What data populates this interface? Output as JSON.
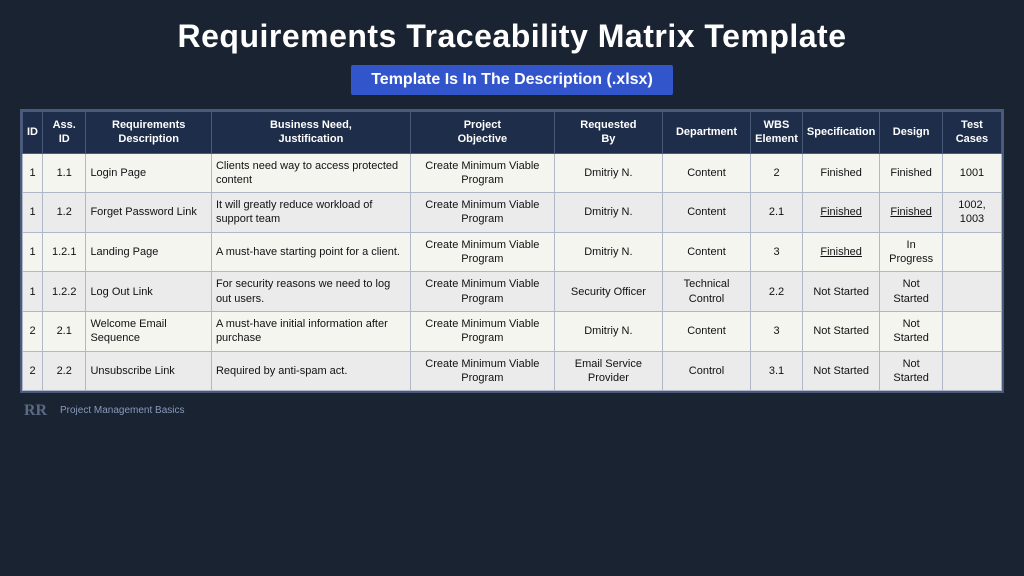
{
  "title": "Requirements Traceability Matrix Template",
  "subtitle": "Template Is In The Description (.xlsx)",
  "table": {
    "headers": [
      {
        "label": "ID",
        "key": "id"
      },
      {
        "label": "Ass. ID",
        "key": "ass_id"
      },
      {
        "label": "Requirements Description",
        "key": "req_desc"
      },
      {
        "label": "Business Need, Justification",
        "key": "business_need"
      },
      {
        "label": "Project Objective",
        "key": "project_obj"
      },
      {
        "label": "Requested By",
        "key": "requested_by"
      },
      {
        "label": "Department",
        "key": "department"
      },
      {
        "label": "WBS Element",
        "key": "wbs"
      },
      {
        "label": "Specification",
        "key": "specification"
      },
      {
        "label": "Design",
        "key": "design"
      },
      {
        "label": "Test Cases",
        "key": "test_cases"
      }
    ],
    "rows": [
      {
        "id": "1",
        "ass_id": "1.1",
        "req_desc": "Login Page",
        "business_need": "Clients need way to access protected content",
        "project_obj": "Create Minimum Viable Program",
        "requested_by": "Dmitriy N.",
        "department": "Content",
        "wbs": "2",
        "specification": "Finished",
        "specification_underline": false,
        "design": "Finished",
        "design_underline": false,
        "test_cases": "1001"
      },
      {
        "id": "1",
        "ass_id": "1.2",
        "req_desc": "Forget Password Link",
        "business_need": "It will greatly reduce workload of support team",
        "project_obj": "Create Minimum Viable Program",
        "requested_by": "Dmitriy N.",
        "department": "Content",
        "wbs": "2.1",
        "specification": "Finished",
        "specification_underline": true,
        "design": "Finished",
        "design_underline": true,
        "test_cases": "1002, 1003"
      },
      {
        "id": "1",
        "ass_id": "1.2.1",
        "req_desc": "Landing Page",
        "business_need": "A must-have starting point for a client.",
        "project_obj": "Create Minimum Viable Program",
        "requested_by": "Dmitriy N.",
        "department": "Content",
        "wbs": "3",
        "specification": "Finished",
        "specification_underline": true,
        "design": "In Progress",
        "design_underline": false,
        "test_cases": ""
      },
      {
        "id": "1",
        "ass_id": "1.2.2",
        "req_desc": "Log Out Link",
        "business_need": "For security reasons we need to log out users.",
        "project_obj": "Create Minimum Viable Program",
        "requested_by": "Security Officer",
        "department": "Technical Control",
        "wbs": "2.2",
        "specification": "Not Started",
        "specification_underline": false,
        "design": "Not Started",
        "design_underline": false,
        "test_cases": ""
      },
      {
        "id": "2",
        "ass_id": "2.1",
        "req_desc": "Welcome Email Sequence",
        "business_need": "A must-have initial information after purchase",
        "project_obj": "Create Minimum Viable Program",
        "requested_by": "Dmitriy N.",
        "department": "Content",
        "wbs": "3",
        "specification": "Not Started",
        "specification_underline": false,
        "design": "Not Started",
        "design_underline": false,
        "test_cases": ""
      },
      {
        "id": "2",
        "ass_id": "2.2",
        "req_desc": "Unsubscribe Link",
        "business_need": "Required by anti-spam act.",
        "project_obj": "Create Minimum Viable Program",
        "requested_by": "Email Service Provider",
        "department": "Control",
        "wbs": "3.1",
        "specification": "Not Started",
        "specification_underline": false,
        "design": "Not Started",
        "design_underline": false,
        "test_cases": ""
      }
    ]
  },
  "footer": {
    "brand": "Project Management Basics"
  }
}
